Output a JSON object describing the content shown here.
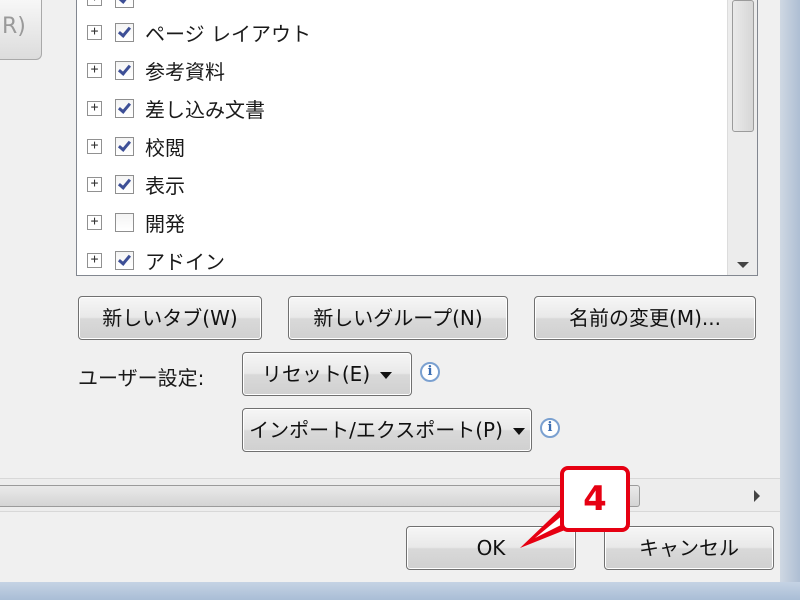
{
  "left_button": {
    "label": "R)"
  },
  "tree": {
    "items": [
      {
        "label": "ページ レイアウト",
        "checked": true
      },
      {
        "label": "参考資料",
        "checked": true
      },
      {
        "label": "差し込み文書",
        "checked": true
      },
      {
        "label": "校閲",
        "checked": true
      },
      {
        "label": "表示",
        "checked": true
      },
      {
        "label": "開発",
        "checked": false
      },
      {
        "label": "アドイン",
        "checked": true
      }
    ]
  },
  "buttons": {
    "new_tab": "新しいタブ(W)",
    "new_group": "新しいグループ(N)",
    "rename": "名前の変更(M)..."
  },
  "customization": {
    "label": "ユーザー設定:",
    "reset": "リセット(E)",
    "import_export": "インポート/エクスポート(P)"
  },
  "footer": {
    "ok": "OK",
    "cancel": "キャンセル"
  },
  "callout": {
    "number": "4"
  },
  "colors": {
    "callout": "#e60012",
    "check": "#3d4f96"
  }
}
